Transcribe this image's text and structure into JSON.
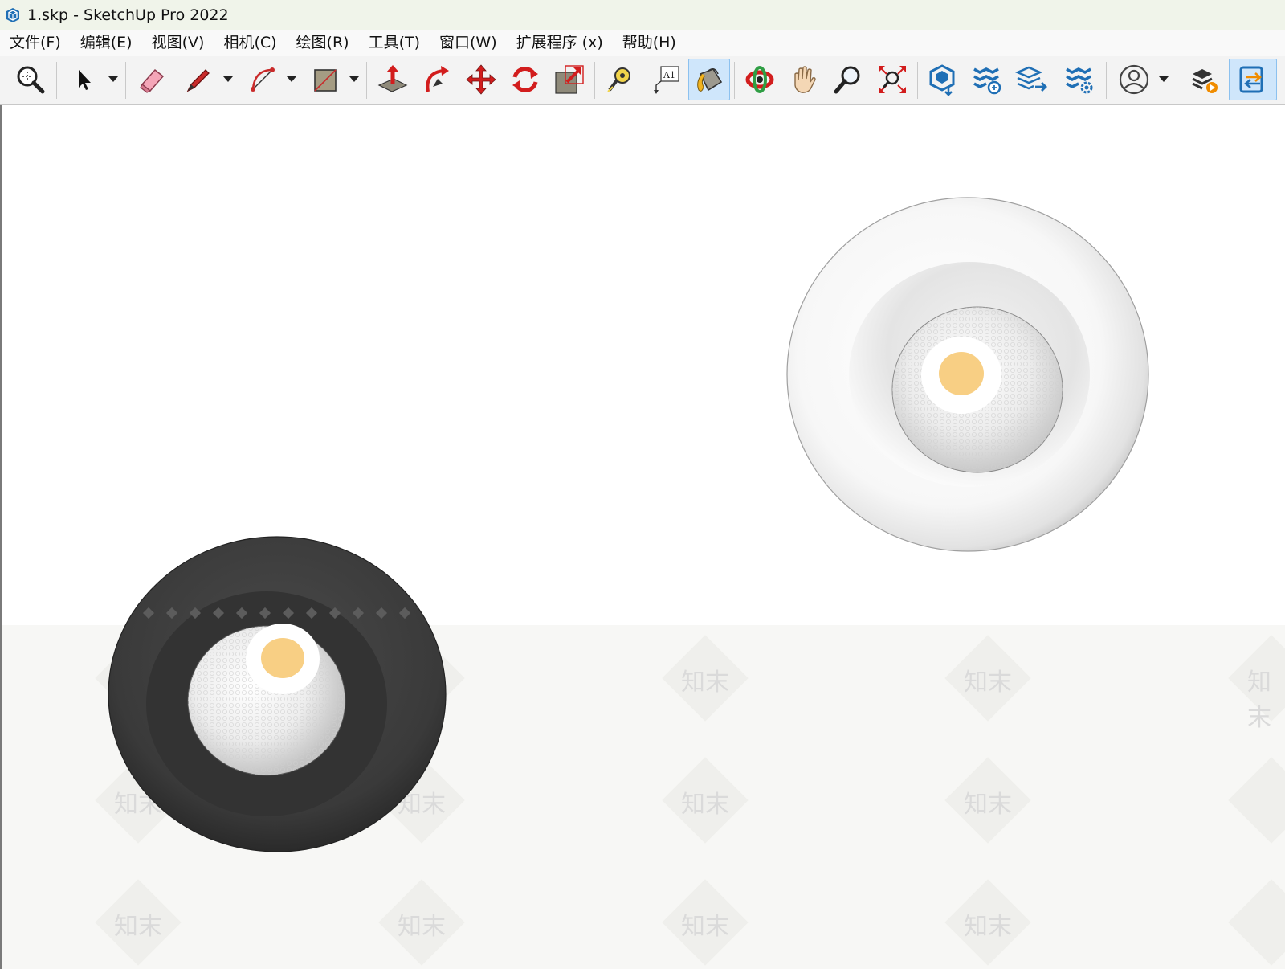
{
  "window": {
    "title": "1.skp - SketchUp Pro 2022",
    "app_icon": "sketchup-logo-icon"
  },
  "menu": [
    {
      "label": "文件(F)"
    },
    {
      "label": "编辑(E)"
    },
    {
      "label": "视图(V)"
    },
    {
      "label": "相机(C)"
    },
    {
      "label": "绘图(R)"
    },
    {
      "label": "工具(T)"
    },
    {
      "label": "窗口(W)"
    },
    {
      "label": "扩展程序 (x)"
    },
    {
      "label": "帮助(H)"
    }
  ],
  "toolbar": {
    "tools": [
      {
        "icon": "zoom-window-icon"
      },
      {
        "icon": "select-arrow-icon",
        "has_dropdown": true
      },
      {
        "icon": "eraser-icon"
      },
      {
        "icon": "pencil-line-icon",
        "has_dropdown": true
      },
      {
        "icon": "arc-icon",
        "has_dropdown": true
      },
      {
        "icon": "rectangle-icon",
        "has_dropdown": true
      },
      {
        "icon": "push-pull-icon"
      },
      {
        "icon": "follow-me-icon"
      },
      {
        "icon": "move-icon"
      },
      {
        "icon": "rotate-icon"
      },
      {
        "icon": "scale-icon"
      },
      {
        "icon": "tape-measure-icon"
      },
      {
        "icon": "text-label-icon"
      },
      {
        "icon": "paint-bucket-icon",
        "active": true
      },
      {
        "icon": "orbit-icon"
      },
      {
        "icon": "pan-hand-icon"
      },
      {
        "icon": "zoom-icon"
      },
      {
        "icon": "zoom-extents-icon"
      },
      {
        "icon": "3d-warehouse-icon"
      },
      {
        "icon": "extension-warehouse-icon"
      },
      {
        "icon": "layout-send-icon"
      },
      {
        "icon": "extension-manager-icon"
      },
      {
        "icon": "account-user-icon",
        "has_dropdown": true
      },
      {
        "icon": "trimble-connect-icon"
      },
      {
        "icon": "sync-panel-icon"
      }
    ]
  },
  "watermark": {
    "text": "知末"
  },
  "colors": {
    "accent": "#1f6fb5",
    "active_tool_bg": "#cfe6fb",
    "lamp_warm": "#f8cf84",
    "dark_housing": "#3a3a3a"
  }
}
